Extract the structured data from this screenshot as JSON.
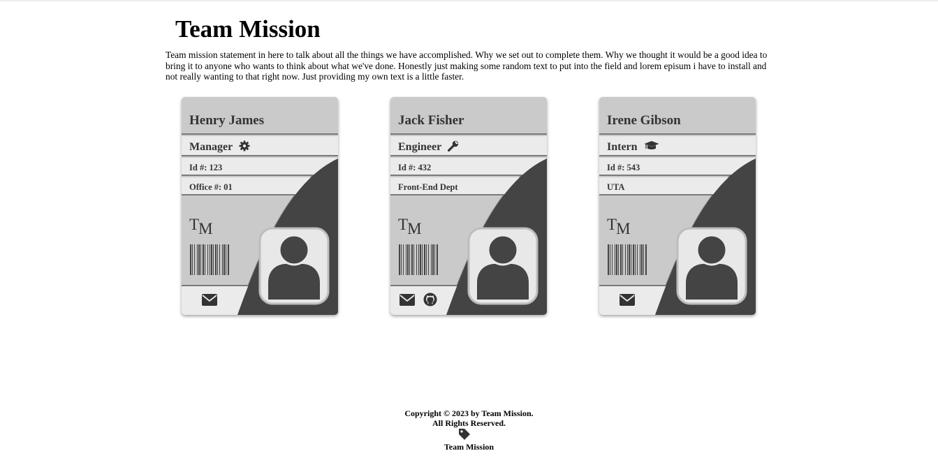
{
  "page": {
    "title": "Team Mission",
    "mission": "Team mission statement in here to talk about all the things we have accomplished. Why we set out to complete them. Why we thought it would be a good idea to bring it to anyone who wants to think about what we've done. Honestly just making some random text to put into the field and lorem episum i have to install and not really wanting to that right now. Just providing my own text is a little faster."
  },
  "cards": [
    {
      "name": "Henry James",
      "role": "Manager",
      "role_icon": "gear-icon",
      "id_line": "Id #:  123",
      "detail_line": "Office #:  01",
      "logo_t": "T",
      "logo_m": "M",
      "contacts": [
        "envelope-icon"
      ]
    },
    {
      "name": "Jack Fisher",
      "role": "Engineer",
      "role_icon": "wrench-icon",
      "id_line": "Id #:  432",
      "detail_line": "Front-End Dept",
      "logo_t": "T",
      "logo_m": "M",
      "contacts": [
        "envelope-icon",
        "github-icon"
      ]
    },
    {
      "name": "Irene Gibson",
      "role": "Intern",
      "role_icon": "graduation-cap-icon",
      "id_line": "Id #:  543",
      "detail_line": "UTA",
      "logo_t": "T",
      "logo_m": "M",
      "contacts": [
        "envelope-icon"
      ]
    }
  ],
  "footer": {
    "copyright": "Copyright © 2023 by Team Mission.",
    "rights": "All Rights Reserved.",
    "icon": "tag-icon",
    "brand": "Team Mission"
  },
  "colors": {
    "card_dark": "#444444",
    "card_mid": "#cacaca",
    "card_light": "#ebebeb",
    "divider": "#7a7a7a"
  }
}
